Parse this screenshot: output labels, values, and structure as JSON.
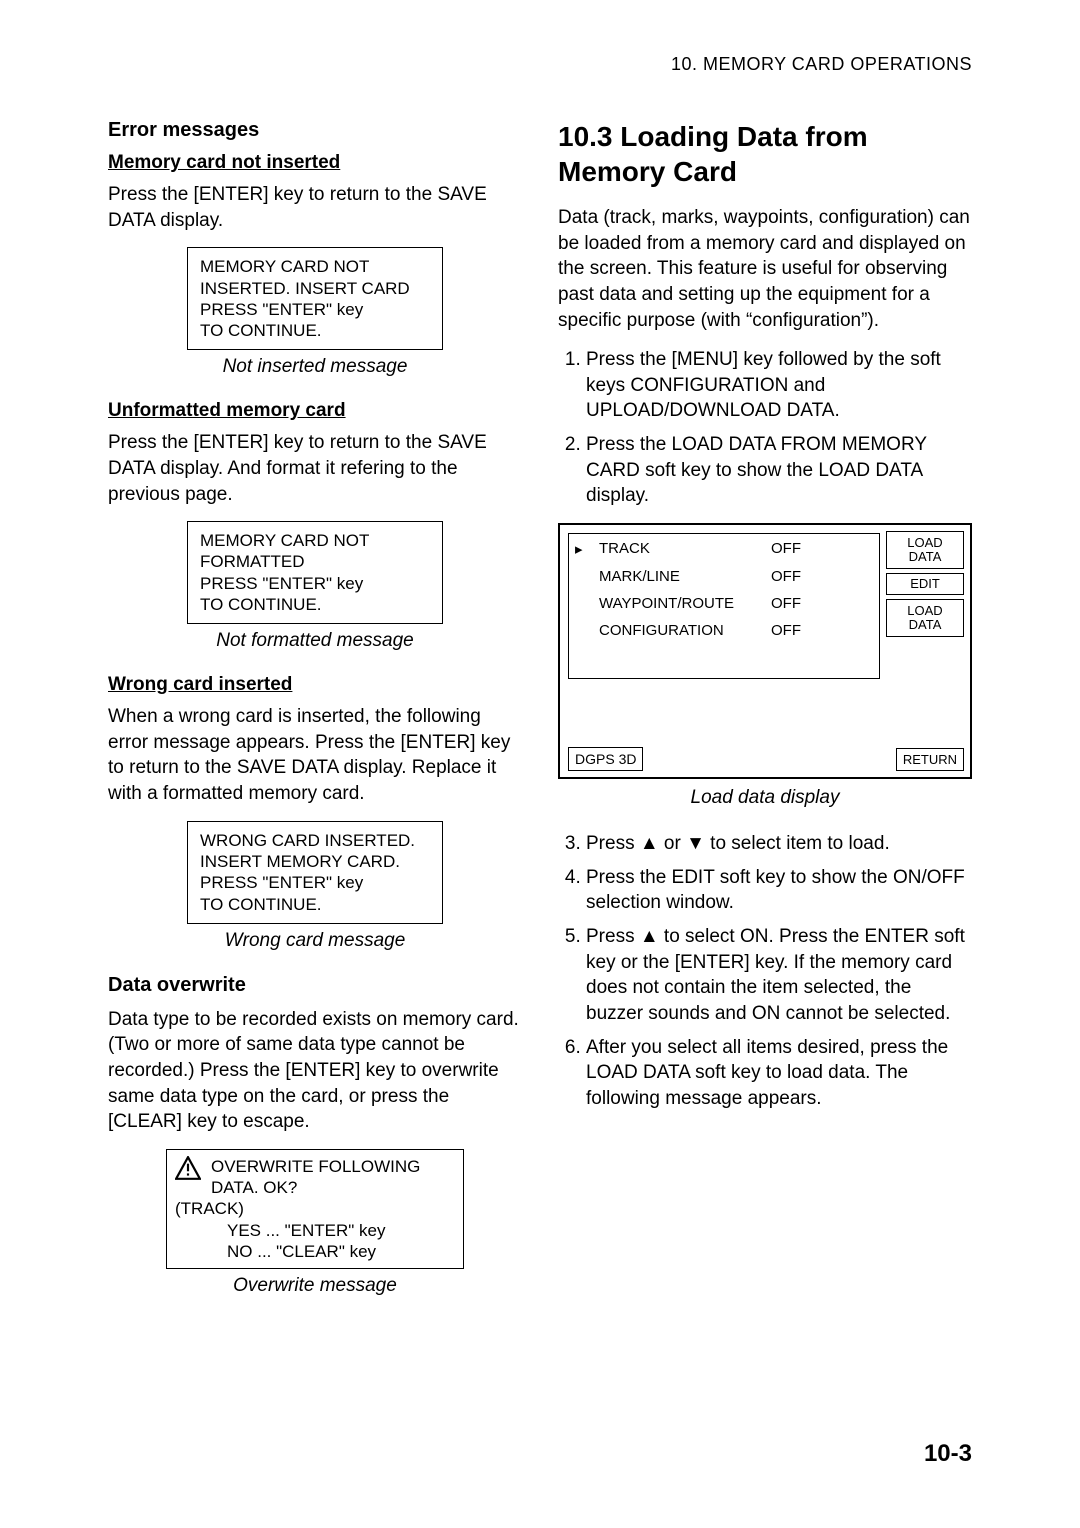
{
  "header": {
    "running": "10.  MEMORY  CARD  OPERATIONS"
  },
  "left": {
    "h_error": "Error messages",
    "h_not_inserted": "Memory card not inserted",
    "p_not_inserted": "Press the [ENTER] key to return to the SAVE DATA display.",
    "box_not_inserted": {
      "l1": "MEMORY CARD NOT",
      "l2": "INSERTED. INSERT CARD",
      "l3": "PRESS \"ENTER\" key",
      "l4": "TO CONTINUE."
    },
    "cap_not_inserted": "Not inserted message",
    "h_unformatted": "Unformatted memory card",
    "p_unformatted": "Press the [ENTER] key to return to the SAVE DATA display. And format it refering to the previous page.",
    "box_unformatted": {
      "l1": "MEMORY CARD NOT",
      "l2": "FORMATTED",
      "l3": "PRESS \"ENTER\" key",
      "l4": "TO CONTINUE."
    },
    "cap_unformatted": "Not formatted message",
    "h_wrong": "Wrong card inserted",
    "p_wrong": "When a wrong card is inserted, the following error message appears. Press the [ENTER] key to return to the SAVE DATA display. Replace it with a formatted memory card.",
    "box_wrong": {
      "l1": "WRONG CARD INSERTED.",
      "l2": "INSERT MEMORY CARD.",
      "l3": "PRESS \"ENTER\" key",
      "l4": "TO CONTINUE."
    },
    "cap_wrong": "Wrong card message",
    "h_overwrite": "Data overwrite",
    "p_overwrite": "Data type to be recorded exists on memory card. (Two or more of same data type cannot be recorded.) Press the [ENTER] key to overwrite same data type on the card, or press the [CLEAR] key to escape.",
    "box_overwrite": {
      "l1": "OVERWRITE FOLLOWING",
      "l2": "DATA. OK?",
      "track": "(TRACK)",
      "yes": "YES  ... \"ENTER\" key",
      "no": "NO   ... \"CLEAR\" key"
    },
    "cap_overwrite": "Overwrite message"
  },
  "right": {
    "h_section": "10.3  Loading Data from Memory Card",
    "p_intro": "Data (track, marks, waypoints, configuration) can be loaded from a memory card and displayed on the screen. This feature is useful for observing past data and setting up the equipment for a specific purpose (with “configuration”).",
    "steps_a": [
      "Press the [MENU] key followed by the soft keys CONFIGURATION and UPLOAD/DOWNLOAD DATA.",
      "Press the LOAD DATA FROM MEMORY CARD soft key to show the LOAD DATA display."
    ],
    "load": {
      "rows": [
        {
          "label": "TRACK",
          "value": "OFF",
          "cursor": true
        },
        {
          "label": "MARK/LINE",
          "value": "OFF",
          "cursor": false
        },
        {
          "label": "WAYPOINT/ROUTE",
          "value": "OFF",
          "cursor": false
        },
        {
          "label": "CONFIGURATION",
          "value": "OFF",
          "cursor": false
        }
      ],
      "softkeys": {
        "k1a": "LOAD",
        "k1b": "DATA",
        "k2": "EDIT",
        "k3a": "LOAD",
        "k3b": "DATA"
      },
      "status": "DGPS 3D",
      "ret": "RETURN"
    },
    "cap_load": "Load data display",
    "steps_b": [
      "Press ▲ or ▼ to select item to load.",
      "Press the EDIT soft key to show the ON/OFF selection window.",
      "Press ▲ to select ON. Press the ENTER soft key or the [ENTER] key. If the memory card does not contain the item selected, the buzzer sounds and ON cannot be selected.",
      "After you select all items desired, press the LOAD DATA soft key to load data. The following message appears."
    ]
  },
  "page_number": "10-3"
}
